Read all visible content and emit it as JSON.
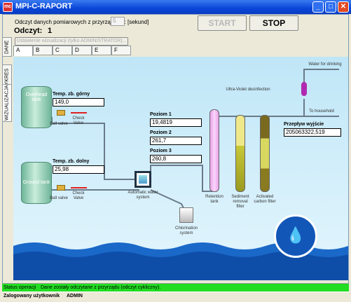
{
  "window": {
    "title": "MPI-C-RAPORT",
    "icon_text": "mc",
    "buttons": {
      "minimize": "_",
      "maximize": "□",
      "close": "✕"
    }
  },
  "controls": {
    "interval_label": "Odczyt danych pomiarowych z przyrządu co:",
    "interval_value": "5",
    "interval_unit": "[sekund]",
    "reading_label": "Odczyt:",
    "reading_value": "1",
    "start_label": "START",
    "stop_label": "STOP",
    "settings_label": "Ustawienie wizualizacji (tylko ADMINISTRATOR)..."
  },
  "side_tabs": [
    "DANE",
    "WYKRES",
    "WIZUALIZACJA"
  ],
  "letter_tabs": [
    "A",
    "B",
    "C",
    "D",
    "E",
    "F"
  ],
  "diagram": {
    "overhead_tank": "Overhead tank",
    "ground_tank": "Ground tank",
    "ball_valve": "Ball valve",
    "check_valve": "Check Valve",
    "temp_top_label": "Temp. zb. górny",
    "temp_top_value": "149,0",
    "temp_bottom_label": "Temp. zb. dolny",
    "temp_bottom_value": "25,98",
    "level1_label": "Poziom 1",
    "level1_value": "19,4819",
    "level2_label": "Poziom 2",
    "level2_value": "261,7",
    "level3_label": "Poziom 3",
    "level3_value": "260,8",
    "automatic_system": "Automatic water system",
    "chlorination": "Chlorination system",
    "uv": "Ultra-Violet desinfection",
    "water_drinking": "Water for drinking",
    "to_household": "To household",
    "flow_label": "Przepływ wyjście",
    "flow_value": "205063322,519",
    "retention": "Retention tank",
    "sediment": "Sediment removal filter",
    "carbon": "Activated carbon filter"
  },
  "status": {
    "label": "Status operacji",
    "message": "Dane zostały odczytane z przyrządu (odczyt cykliczny)."
  },
  "user": {
    "label": "Zalogowany użytkownik",
    "name": "ADMIN"
  }
}
